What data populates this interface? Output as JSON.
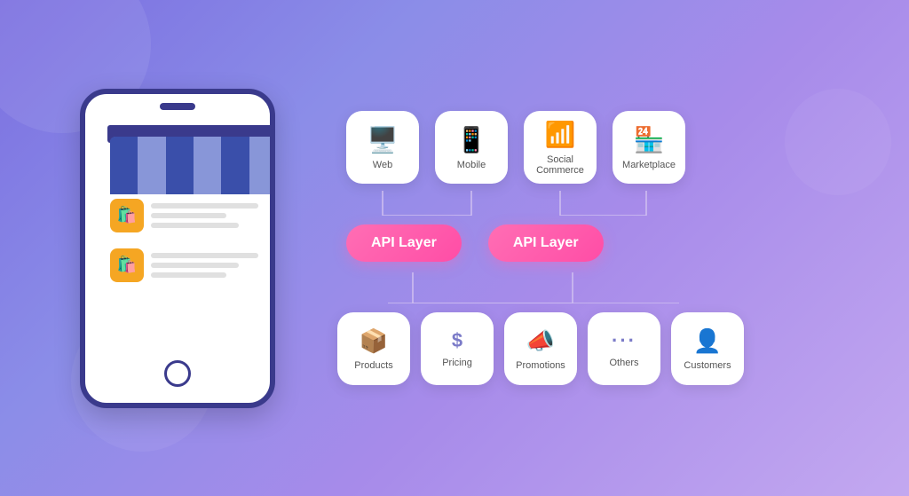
{
  "background": {
    "gradient_start": "#7b6fe0",
    "gradient_end": "#c3a8f0"
  },
  "phone": {
    "awning_colors": [
      "dark_blue",
      "light_blue"
    ],
    "products": [
      {
        "icon": "🛍️"
      },
      {
        "icon": "🛍️"
      }
    ]
  },
  "diagram": {
    "top_icons": [
      {
        "label": "Web",
        "symbol": "🖥️",
        "id": "web"
      },
      {
        "label": "Mobile",
        "symbol": "📱",
        "id": "mobile"
      },
      {
        "label": "Social Commerce",
        "symbol": "📶",
        "id": "social"
      },
      {
        "label": "Marketplace",
        "symbol": "🏪",
        "id": "marketplace"
      }
    ],
    "api_layers": [
      {
        "label": "API Layer",
        "id": "api1"
      },
      {
        "label": "API Layer",
        "id": "api2"
      }
    ],
    "bottom_icons": [
      {
        "label": "Products",
        "symbol": "📦",
        "id": "products"
      },
      {
        "label": "Pricing",
        "symbol": "$",
        "id": "pricing"
      },
      {
        "label": "Promotions",
        "symbol": "📣",
        "id": "promotions"
      },
      {
        "label": "Others",
        "symbol": "···",
        "id": "others"
      },
      {
        "label": "Customers",
        "symbol": "👤",
        "id": "customers"
      }
    ]
  }
}
